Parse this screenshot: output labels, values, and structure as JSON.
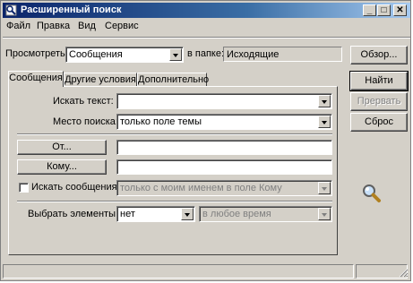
{
  "window": {
    "title": "Расширенный поиск",
    "controls": {
      "minimize": "_",
      "maximize": "□",
      "close": "✕"
    }
  },
  "menu": [
    "Файл",
    "Правка",
    "Вид",
    "Сервис"
  ],
  "lookin": {
    "label": "Просмотреть:",
    "value": "Сообщения",
    "folder_label": "в папке:",
    "folder_value": "Исходящие"
  },
  "tabs": [
    "Сообщения",
    "Другие условия",
    "Дополнительно"
  ],
  "form": {
    "search_text_label": "Искать текст:",
    "search_text_value": "",
    "search_in_label": "Место поиска:",
    "search_in_value": "только поле темы",
    "from_button": "От...",
    "from_value": "",
    "to_button": "Кому...",
    "to_value": "",
    "where_label": "Искать сообщения:",
    "where_value": "только с моим именем в поле Кому",
    "time_label": "Выбрать элементы:",
    "time_value": "нет",
    "time_range_value": "в любое время"
  },
  "buttons": {
    "browse": "Обзор...",
    "find": "Найти",
    "stop": "Прервать",
    "reset": "Сброс"
  },
  "icons": {
    "search": "magnifier-icon",
    "app": "find-window-icon"
  },
  "colors": {
    "titlebar_start": "#0a246a",
    "titlebar_end": "#a6caf0",
    "face": "#d4d0c8"
  }
}
